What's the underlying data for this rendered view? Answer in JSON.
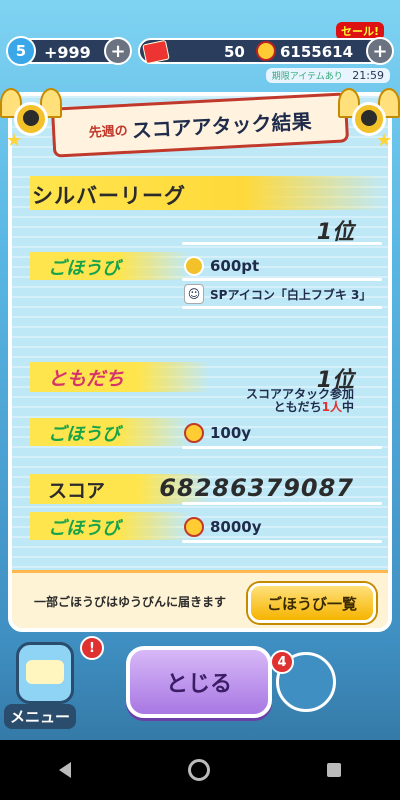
{
  "status": {
    "stamina": "5",
    "hearts": "+999",
    "tickets": "50",
    "money": "6155614",
    "sale": "セール!",
    "timer_label": "期限アイテムあり",
    "time": "21:59"
  },
  "panel": {
    "title_prefix": "先週の",
    "title": "スコアアタック結果",
    "league": "シルバーリーグ",
    "league_rank": "1位",
    "reward_label": "ごほうび",
    "league_reward_points": "600pt",
    "league_reward_item": "SPアイコン「白上フブキ 3」",
    "friends_label": "ともだち",
    "friends_rank": "1位",
    "friends_note_line1": "スコアアタック参加",
    "friends_note_line2_a": "ともだち",
    "friends_note_line2_count": "1人",
    "friends_note_line2_b": "中",
    "friends_reward": "100y",
    "score_label": "スコア",
    "score_value": "68286379087",
    "score_reward": "8000y",
    "footer_text": "一部ごほうびはゆうびんに届きます",
    "reward_list_button": "ごほうび一覧"
  },
  "bottom": {
    "menu_label": "メニュー",
    "menu_badge": "!",
    "close_button": "とじる",
    "right_badge": "4"
  }
}
